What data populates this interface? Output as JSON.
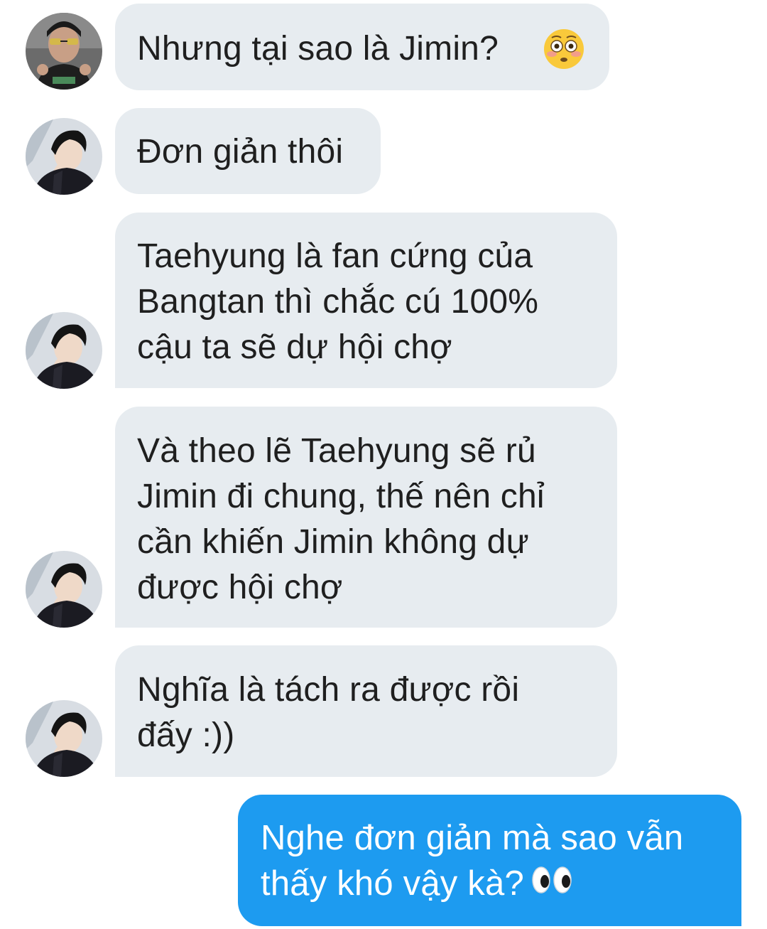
{
  "conversation": {
    "messages": [
      {
        "sender": "other",
        "avatar_icon": "user-avatar-icon",
        "lines": [
          "Nhưng tại sao là Jimin?"
        ],
        "emoji_icon": "flushed-face-icon"
      },
      {
        "sender": "other",
        "avatar_icon": "user-avatar-icon",
        "lines": [
          "Đơn giản thôi"
        ]
      },
      {
        "sender": "other",
        "avatar_icon": "user-avatar-icon",
        "lines": [
          "Taehyung là fan cứng của",
          "Bangtan thì chắc cú 100%",
          "cậu ta sẽ dự hội chợ"
        ]
      },
      {
        "sender": "other",
        "avatar_icon": "user-avatar-icon",
        "lines": [
          "Và theo lẽ Taehyung sẽ rủ",
          "Jimin đi chung, thế nên chỉ",
          "cần khiến Jimin không dự",
          "được hội chợ"
        ]
      },
      {
        "sender": "other",
        "avatar_icon": "user-avatar-icon",
        "lines": [
          "Nghĩa là tách ra được rồi",
          "đấy :))"
        ]
      },
      {
        "sender": "self",
        "lines": [
          "Nghe đơn giản mà sao vẫn",
          "thấy khó vậy kà?"
        ],
        "emoji_icon": "eyes-icon"
      }
    ]
  },
  "colors": {
    "incoming_bubble": "#e7ecf0",
    "outgoing_bubble": "#1d9bf0",
    "incoming_text": "#1f1f1f",
    "outgoing_text": "#ffffff"
  }
}
